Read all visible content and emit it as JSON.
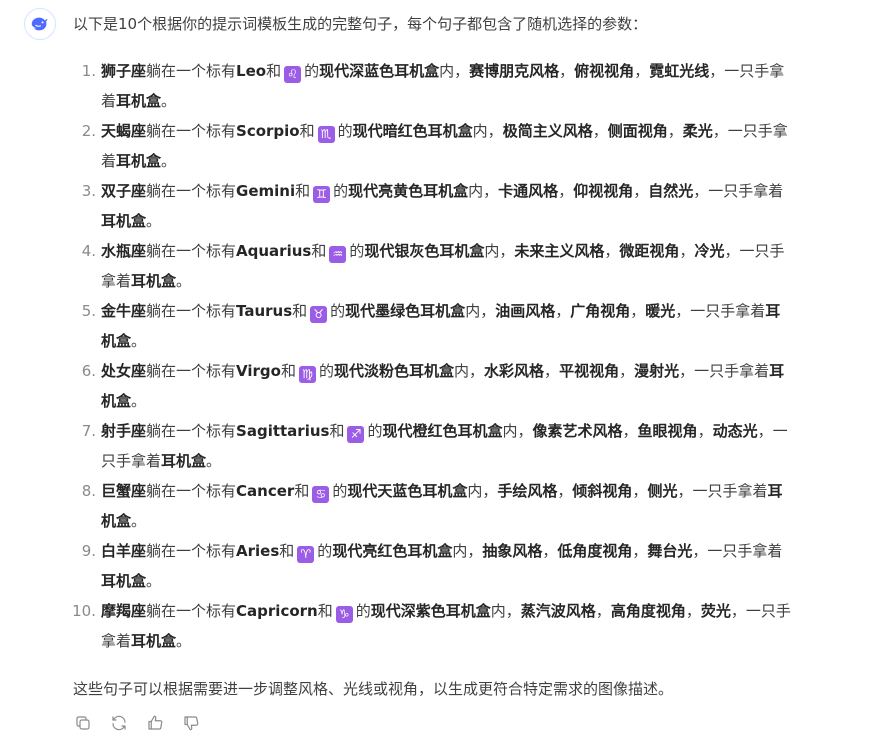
{
  "assistant": {
    "avatar_icon": "deepseek-whale-icon",
    "accent_color": "#4d6bfe",
    "intro": "以下是10个根据你的提示词模板生成的完整句子，每个句子都包含了随机选择的参数：",
    "items": [
      {
        "num": "1.",
        "parts": [
          {
            "text": "狮子座",
            "bold": true
          },
          {
            "text": "躺在一个标有",
            "bold": false
          },
          {
            "text": "Leo",
            "bold": true
          },
          {
            "text": "和",
            "bold": false
          },
          {
            "symbol": "♌",
            "icon": "leo-symbol-icon"
          },
          {
            "text": "的",
            "bold": false
          },
          {
            "text": "现代深蓝色耳机盒",
            "bold": true
          },
          {
            "text": "内，",
            "bold": false
          },
          {
            "text": "赛博朋克风格",
            "bold": true
          },
          {
            "text": "，",
            "bold": false
          },
          {
            "text": "俯视视角",
            "bold": true
          },
          {
            "text": "，",
            "bold": false
          },
          {
            "text": "霓虹光线",
            "bold": true
          },
          {
            "text": "，一只手拿",
            "bold": false
          },
          {
            "br": true
          },
          {
            "text": "着",
            "bold": false
          },
          {
            "text": "耳机盒",
            "bold": true
          },
          {
            "text": "。",
            "bold": false
          }
        ]
      },
      {
        "num": "2.",
        "parts": [
          {
            "text": "天蝎座",
            "bold": true
          },
          {
            "text": "躺在一个标有",
            "bold": false
          },
          {
            "text": "Scorpio",
            "bold": true
          },
          {
            "text": "和",
            "bold": false
          },
          {
            "symbol": "♏",
            "icon": "scorpio-symbol-icon"
          },
          {
            "text": "的",
            "bold": false
          },
          {
            "text": "现代暗红色耳机盒",
            "bold": true
          },
          {
            "text": "内，",
            "bold": false
          },
          {
            "text": "极简主义风格",
            "bold": true
          },
          {
            "text": "，",
            "bold": false
          },
          {
            "text": "侧面视角",
            "bold": true
          },
          {
            "text": "，",
            "bold": false
          },
          {
            "text": "柔光",
            "bold": true
          },
          {
            "text": "，一只手拿",
            "bold": false
          },
          {
            "br": true
          },
          {
            "text": "着",
            "bold": false
          },
          {
            "text": "耳机盒",
            "bold": true
          },
          {
            "text": "。",
            "bold": false
          }
        ]
      },
      {
        "num": "3.",
        "parts": [
          {
            "text": "双子座",
            "bold": true
          },
          {
            "text": "躺在一个标有",
            "bold": false
          },
          {
            "text": "Gemini",
            "bold": true
          },
          {
            "text": "和",
            "bold": false
          },
          {
            "symbol": "♊",
            "icon": "gemini-symbol-icon"
          },
          {
            "text": "的",
            "bold": false
          },
          {
            "text": "现代亮黄色耳机盒",
            "bold": true
          },
          {
            "text": "内，",
            "bold": false
          },
          {
            "text": "卡通风格",
            "bold": true
          },
          {
            "text": "，",
            "bold": false
          },
          {
            "text": "仰视视角",
            "bold": true
          },
          {
            "text": "，",
            "bold": false
          },
          {
            "text": "自然光",
            "bold": true
          },
          {
            "text": "，一只手拿着",
            "bold": false
          },
          {
            "br": true
          },
          {
            "text": "耳机盒",
            "bold": true
          },
          {
            "text": "。",
            "bold": false
          }
        ]
      },
      {
        "num": "4.",
        "parts": [
          {
            "text": "水瓶座",
            "bold": true
          },
          {
            "text": "躺在一个标有",
            "bold": false
          },
          {
            "text": "Aquarius",
            "bold": true
          },
          {
            "text": "和",
            "bold": false
          },
          {
            "symbol": "♒",
            "icon": "aquarius-symbol-icon"
          },
          {
            "text": "的",
            "bold": false
          },
          {
            "text": "现代银灰色耳机盒",
            "bold": true
          },
          {
            "text": "内，",
            "bold": false
          },
          {
            "text": "未来主义风格",
            "bold": true
          },
          {
            "text": "，",
            "bold": false
          },
          {
            "text": "微距视角",
            "bold": true
          },
          {
            "text": "，",
            "bold": false
          },
          {
            "text": "冷光",
            "bold": true
          },
          {
            "text": "，一只手",
            "bold": false
          },
          {
            "br": true
          },
          {
            "text": "拿着",
            "bold": false
          },
          {
            "text": "耳机盒",
            "bold": true
          },
          {
            "text": "。",
            "bold": false
          }
        ]
      },
      {
        "num": "5.",
        "parts": [
          {
            "text": "金牛座",
            "bold": true
          },
          {
            "text": "躺在一个标有",
            "bold": false
          },
          {
            "text": "Taurus",
            "bold": true
          },
          {
            "text": "和",
            "bold": false
          },
          {
            "symbol": "♉",
            "icon": "taurus-symbol-icon"
          },
          {
            "text": "的",
            "bold": false
          },
          {
            "text": "现代墨绿色耳机盒",
            "bold": true
          },
          {
            "text": "内，",
            "bold": false
          },
          {
            "text": "油画风格",
            "bold": true
          },
          {
            "text": "，",
            "bold": false
          },
          {
            "text": "广角视角",
            "bold": true
          },
          {
            "text": "，",
            "bold": false
          },
          {
            "text": "暖光",
            "bold": true
          },
          {
            "text": "，一只手拿着",
            "bold": false
          },
          {
            "text": "耳",
            "bold": true
          },
          {
            "br": true
          },
          {
            "text": "机盒",
            "bold": true
          },
          {
            "text": "。",
            "bold": false
          }
        ]
      },
      {
        "num": "6.",
        "parts": [
          {
            "text": "处女座",
            "bold": true
          },
          {
            "text": "躺在一个标有",
            "bold": false
          },
          {
            "text": "Virgo",
            "bold": true
          },
          {
            "text": "和",
            "bold": false
          },
          {
            "symbol": "♍",
            "icon": "virgo-symbol-icon"
          },
          {
            "text": "的",
            "bold": false
          },
          {
            "text": "现代淡粉色耳机盒",
            "bold": true
          },
          {
            "text": "内，",
            "bold": false
          },
          {
            "text": "水彩风格",
            "bold": true
          },
          {
            "text": "，",
            "bold": false
          },
          {
            "text": "平视视角",
            "bold": true
          },
          {
            "text": "，",
            "bold": false
          },
          {
            "text": "漫射光",
            "bold": true
          },
          {
            "text": "，一只手拿着",
            "bold": false
          },
          {
            "text": "耳",
            "bold": true
          },
          {
            "br": true
          },
          {
            "text": "机盒",
            "bold": true
          },
          {
            "text": "。",
            "bold": false
          }
        ]
      },
      {
        "num": "7.",
        "parts": [
          {
            "text": "射手座",
            "bold": true
          },
          {
            "text": "躺在一个标有",
            "bold": false
          },
          {
            "text": "Sagittarius",
            "bold": true
          },
          {
            "text": "和",
            "bold": false
          },
          {
            "symbol": "♐",
            "icon": "sagittarius-symbol-icon"
          },
          {
            "text": "的",
            "bold": false
          },
          {
            "text": "现代橙红色耳机盒",
            "bold": true
          },
          {
            "text": "内，",
            "bold": false
          },
          {
            "text": "像素艺术风格",
            "bold": true
          },
          {
            "text": "，",
            "bold": false
          },
          {
            "text": "鱼眼视角",
            "bold": true
          },
          {
            "text": "，",
            "bold": false
          },
          {
            "text": "动态光",
            "bold": true
          },
          {
            "text": "，一",
            "bold": false
          },
          {
            "br": true
          },
          {
            "text": "只手拿着",
            "bold": false
          },
          {
            "text": "耳机盒",
            "bold": true
          },
          {
            "text": "。",
            "bold": false
          }
        ]
      },
      {
        "num": "8.",
        "parts": [
          {
            "text": "巨蟹座",
            "bold": true
          },
          {
            "text": "躺在一个标有",
            "bold": false
          },
          {
            "text": "Cancer",
            "bold": true
          },
          {
            "text": "和",
            "bold": false
          },
          {
            "symbol": "♋",
            "icon": "cancer-symbol-icon"
          },
          {
            "text": "的",
            "bold": false
          },
          {
            "text": "现代天蓝色耳机盒",
            "bold": true
          },
          {
            "text": "内，",
            "bold": false
          },
          {
            "text": "手绘风格",
            "bold": true
          },
          {
            "text": "，",
            "bold": false
          },
          {
            "text": "倾斜视角",
            "bold": true
          },
          {
            "text": "，",
            "bold": false
          },
          {
            "text": "侧光",
            "bold": true
          },
          {
            "text": "，一只手拿着",
            "bold": false
          },
          {
            "text": "耳",
            "bold": true
          },
          {
            "br": true
          },
          {
            "text": "机盒",
            "bold": true
          },
          {
            "text": "。",
            "bold": false
          }
        ]
      },
      {
        "num": "9.",
        "parts": [
          {
            "text": "白羊座",
            "bold": true
          },
          {
            "text": "躺在一个标有",
            "bold": false
          },
          {
            "text": "Aries",
            "bold": true
          },
          {
            "text": "和",
            "bold": false
          },
          {
            "symbol": "♈",
            "icon": "aries-symbol-icon"
          },
          {
            "text": "的",
            "bold": false
          },
          {
            "text": "现代亮红色耳机盒",
            "bold": true
          },
          {
            "text": "内，",
            "bold": false
          },
          {
            "text": "抽象风格",
            "bold": true
          },
          {
            "text": "，",
            "bold": false
          },
          {
            "text": "低角度视角",
            "bold": true
          },
          {
            "text": "，",
            "bold": false
          },
          {
            "text": "舞台光",
            "bold": true
          },
          {
            "text": "，一只手拿着",
            "bold": false
          },
          {
            "br": true
          },
          {
            "text": "耳机盒",
            "bold": true
          },
          {
            "text": "。",
            "bold": false
          }
        ]
      },
      {
        "num": "10.",
        "parts": [
          {
            "text": "摩羯座",
            "bold": true
          },
          {
            "text": "躺在一个标有",
            "bold": false
          },
          {
            "text": "Capricorn",
            "bold": true
          },
          {
            "text": "和",
            "bold": false
          },
          {
            "symbol": "♑",
            "icon": "capricorn-symbol-icon"
          },
          {
            "text": "的",
            "bold": false
          },
          {
            "text": "现代深紫色耳机盒",
            "bold": true
          },
          {
            "text": "内，",
            "bold": false
          },
          {
            "text": "蒸汽波风格",
            "bold": true
          },
          {
            "text": "，",
            "bold": false
          },
          {
            "text": "高角度视角",
            "bold": true
          },
          {
            "text": "，",
            "bold": false
          },
          {
            "text": "荧光",
            "bold": true
          },
          {
            "text": "，一只手",
            "bold": false
          },
          {
            "br": true
          },
          {
            "text": "拿着",
            "bold": false
          },
          {
            "text": "耳机盒",
            "bold": true
          },
          {
            "text": "。",
            "bold": false
          }
        ]
      }
    ],
    "outro": "这些句子可以根据需要进一步调整风格、光线或视角，以生成更符合特定需求的图像描述。",
    "actions": [
      {
        "name": "copy-button",
        "icon": "copy-icon"
      },
      {
        "name": "regenerate-button",
        "icon": "regenerate-icon"
      },
      {
        "name": "like-button",
        "icon": "thumbs-up-icon"
      },
      {
        "name": "dislike-button",
        "icon": "thumbs-down-icon"
      }
    ],
    "symbol_color": "#9b5de5"
  }
}
